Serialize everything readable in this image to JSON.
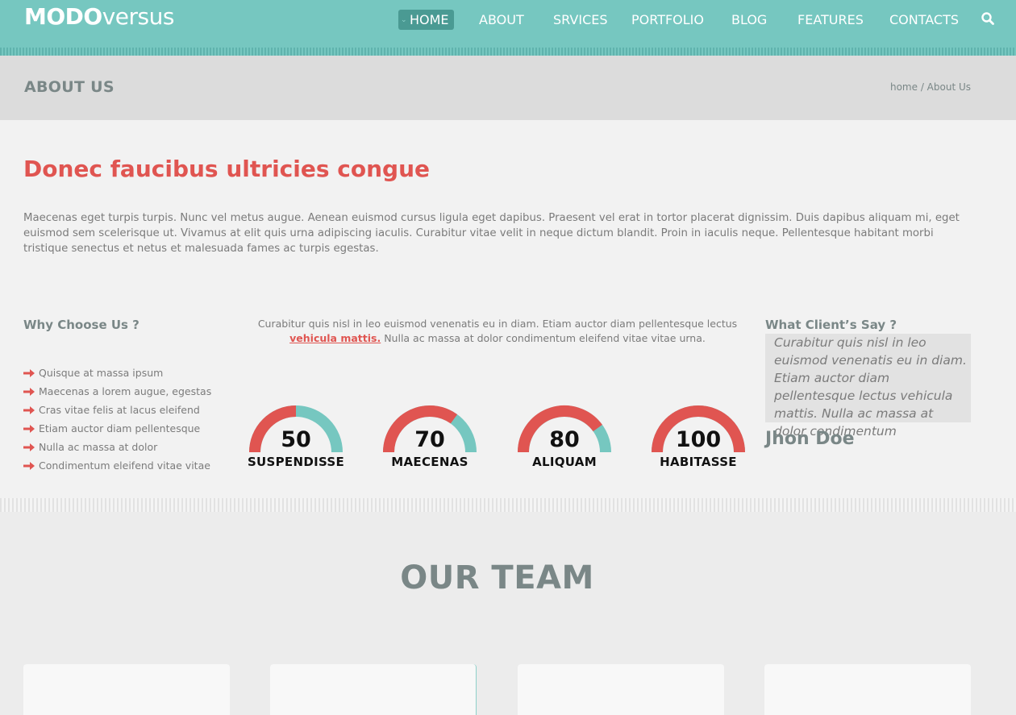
{
  "header": {
    "logo_bold": "MODO",
    "logo_light": "versus",
    "nav": [
      {
        "label": "HOME",
        "active": true
      },
      {
        "label": "ABOUT"
      },
      {
        "label": "SRVICES"
      },
      {
        "label": "PORTFOLIO"
      },
      {
        "label": "BLOG"
      },
      {
        "label": "FEATURES"
      },
      {
        "label": "CONTACTS"
      }
    ],
    "search_icon": "search-icon"
  },
  "pagebar": {
    "title": "ABOUT US",
    "crumb_home": "home",
    "crumb_sep": " / ",
    "crumb_current": "About Us"
  },
  "intro": {
    "headline": "Donec faucibus ultricies congue",
    "text": "Maecenas eget turpis turpis. Nunc vel metus augue. Aenean euismod cursus ligula eget dapibus. Praesent vel erat in tortor placerat dignissim. Duis dapibus aliquam mi, eget euismod sem scelerisque ut. Vivamus at elit quis urna adipiscing iaculis. Curabitur vitae velit in neque dictum blandit. Proin in iaculis neque. Pellentesque habitant morbi tristique senectus et netus et malesuada fames ac turpis egestas."
  },
  "why": {
    "title": "Why Choose Us ?",
    "items": [
      "Quisque at massa ipsum",
      "Maecenas a lorem augue, egestas",
      "Cras vitae felis at lacus eleifend",
      "Etiam auctor diam pellentesque",
      "Nulla ac massa at dolor",
      "Condimentum eleifend vitae vitae"
    ]
  },
  "middle": {
    "text_before": "Curabitur quis nisl in leo euismod venenatis eu in diam. Etiam auctor diam pellentesque lectus ",
    "link": "vehicula mattis.",
    "text_after": " Nulla ac massa at dolor condimentum eleifend vitae vitae urna."
  },
  "gauges": [
    {
      "value": "50",
      "label": "SUSPENDISSE",
      "percent": 50
    },
    {
      "value": "70",
      "label": "MAECENAS",
      "percent": 70
    },
    {
      "value": "80",
      "label": "ALIQUAM",
      "percent": 80
    },
    {
      "value": "100",
      "label": "HABITASSE",
      "percent": 100
    }
  ],
  "client": {
    "title": "What Client’s Say ?",
    "quote": "Curabitur quis nisl in leo euismod venenatis eu in diam. Etiam auctor diam pellentesque lectus vehicula mattis. Nulla ac massa at dolor condimentum",
    "author": "Jhon Doe"
  },
  "team": {
    "title": "OUR TEAM"
  },
  "colors": {
    "teal": "#76c7c0",
    "red": "#e05551",
    "gray_text": "#7a8787"
  }
}
